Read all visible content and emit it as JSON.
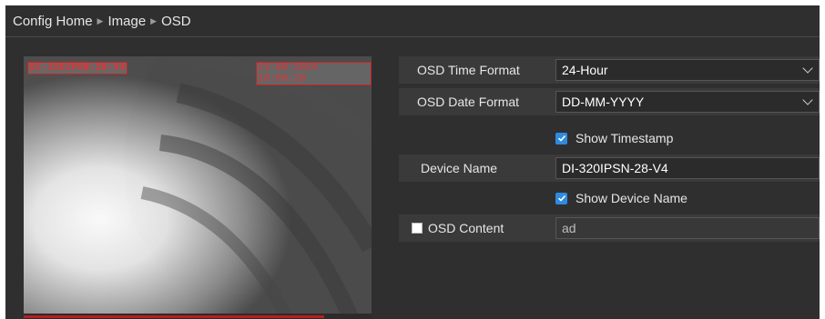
{
  "breadcrumb": {
    "home": "Config Home",
    "section": "Image",
    "page": "OSD"
  },
  "preview": {
    "device_overlay": "DI-320IPSN-28-V4",
    "time_overlay": "23-08-2024 10:09:28"
  },
  "form": {
    "time_format": {
      "label": "OSD Time Format",
      "value": "24-Hour"
    },
    "date_format": {
      "label": "OSD Date Format",
      "value": "DD-MM-YYYY"
    },
    "show_timestamp": {
      "label": "Show Timestamp",
      "checked": true
    },
    "device_name": {
      "label": "Device Name",
      "value": "DI-320IPSN-28-V4"
    },
    "show_device_name": {
      "label": "Show Device Name",
      "checked": true
    },
    "osd_content": {
      "label": "OSD Content",
      "value": "ad",
      "checked": false
    }
  },
  "colors": {
    "accent": "#2f8be0",
    "background": "#2f2f2f",
    "overlay_red": "#e83030"
  }
}
